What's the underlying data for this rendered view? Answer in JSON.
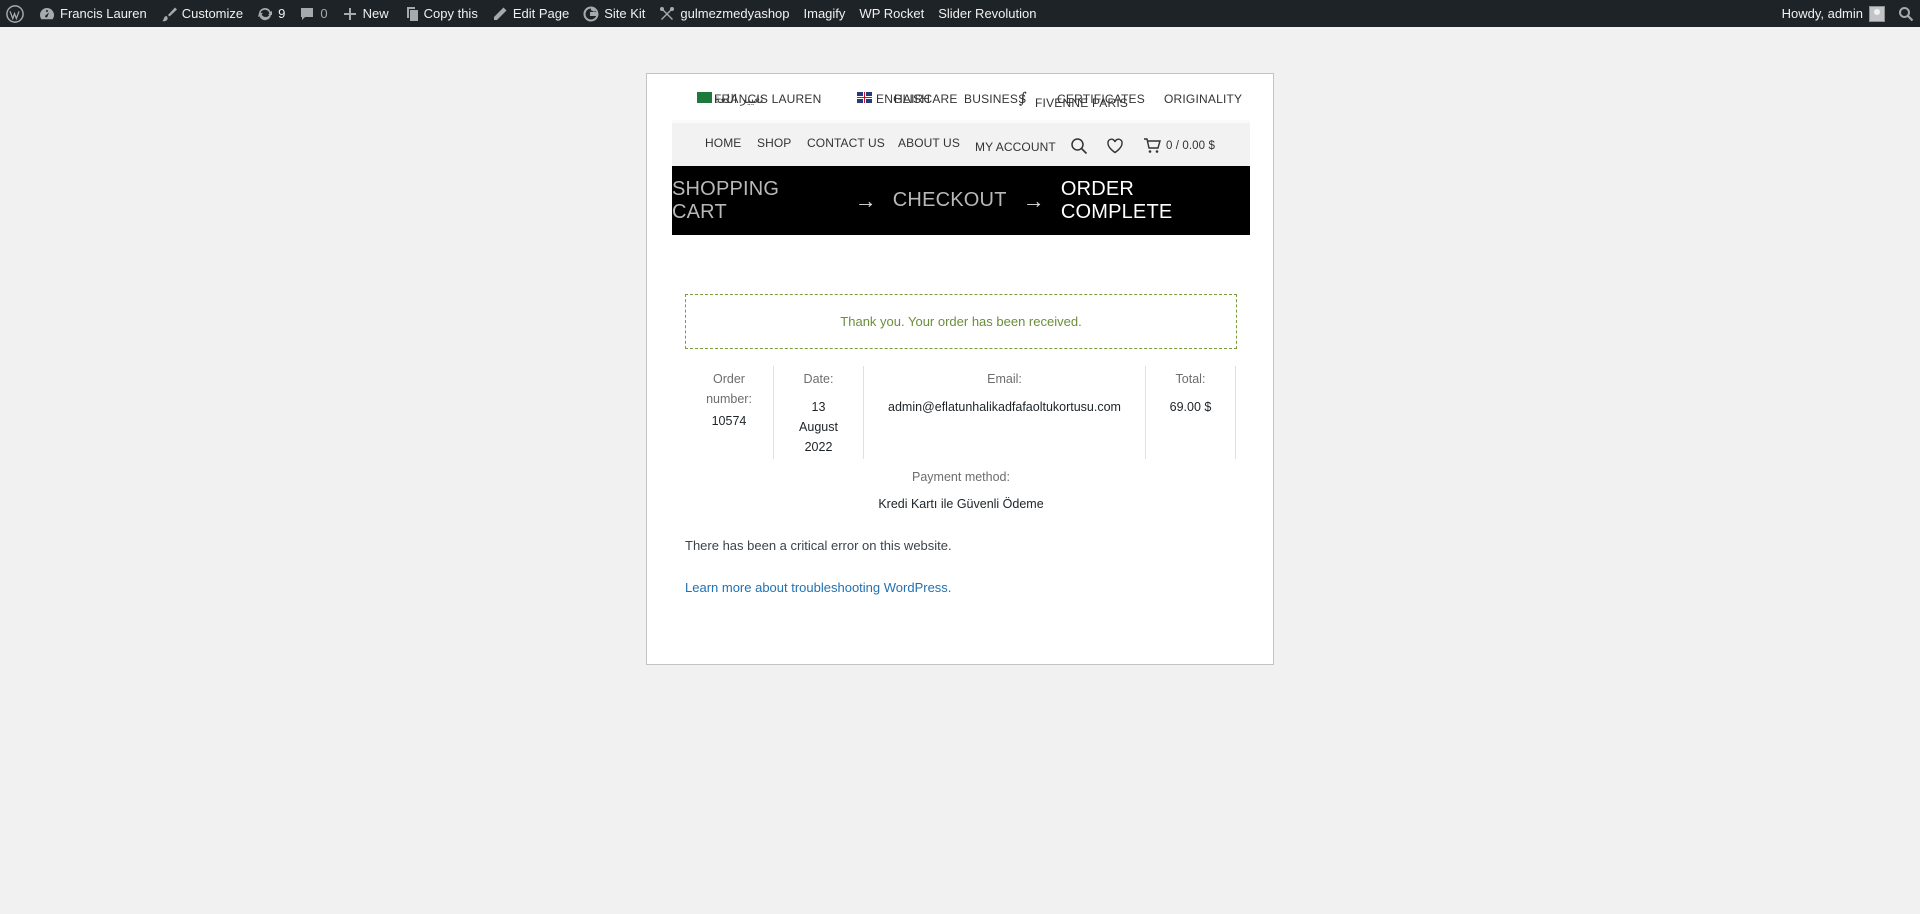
{
  "adminbar": {
    "site_name": "Francis Lauren",
    "customize": "Customize",
    "updates_count": "9",
    "comments_count": "0",
    "new": "New",
    "copy_this": "Copy this",
    "edit_page": "Edit Page",
    "site_kit": "Site Kit",
    "shop_plugin": "gulmezmedyashop",
    "imagify": "Imagify",
    "wp_rocket": "WP Rocket",
    "slider_revolution": "Slider Revolution",
    "howdy": "Howdy, admin"
  },
  "topbar": {
    "brand_ar": "ﺗﻐﻴﻴﺮ ﺍﻟﻠﻐﺔ",
    "brand": "FRANCIS LAUREN",
    "lang": "ENGLISH",
    "haircare": "HAIRCARE",
    "business": "BUSINESS",
    "fivenne": "FIVENNE PARIS",
    "certificates": "CERTIFICATES",
    "originality": "ORIGINALITY"
  },
  "nav": {
    "home": "HOME",
    "shop": "SHOP",
    "contact": "CONTACT US",
    "about": "ABOUT US",
    "account": "MY ACCOUNT",
    "cart_total": "0 / 0.00 $"
  },
  "steps": {
    "cart": "SHOPPING CART",
    "checkout": "CHECKOUT",
    "complete": "ORDER COMPLETE",
    "arrow": "→"
  },
  "order": {
    "notice": "Thank you. Your order has been received.",
    "number_label": "Order number:",
    "number_value": "10574",
    "date_label": "Date:",
    "date_value": "13 August 2022",
    "email_label": "Email:",
    "email_value": "admin@eflatunhalikadfafaoltukortusu.com",
    "total_label": "Total:",
    "total_value": "69.00 $",
    "payment_label": "Payment method:",
    "payment_value": "Kredi Kartı ile Güvenli Ödeme"
  },
  "error": {
    "message": "There has been a critical error on this website.",
    "link": "Learn more about troubleshooting WordPress."
  },
  "colors": {
    "adminbar_bg": "#1d2327",
    "notice_green": "#6b8e3a",
    "link_blue": "#2271b1"
  }
}
